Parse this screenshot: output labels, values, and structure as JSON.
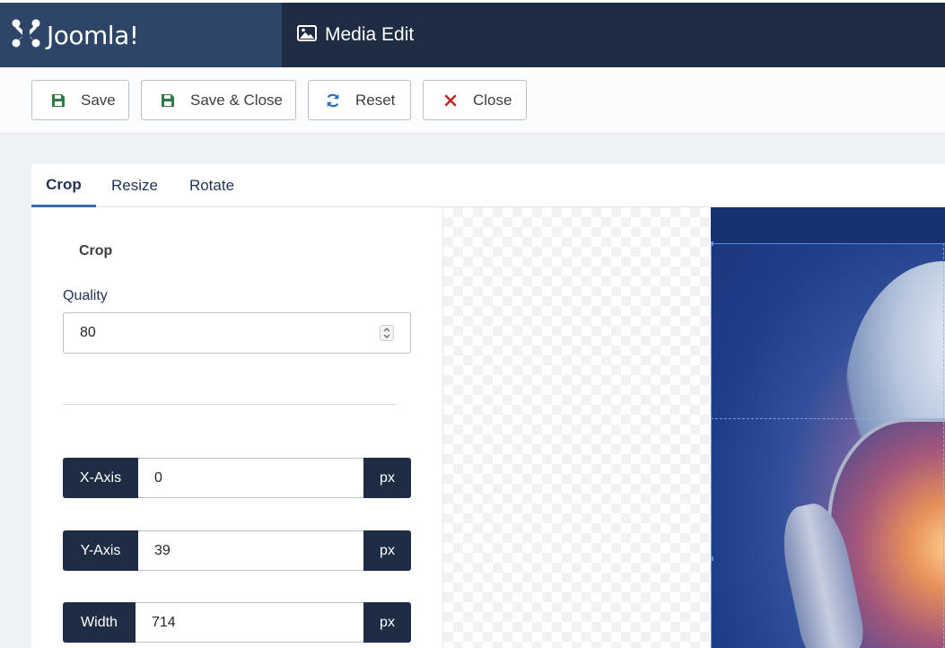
{
  "header": {
    "logo_text": "Joomla!",
    "page_title": "Media Edit"
  },
  "toolbar": {
    "save_label": "Save",
    "save_close_label": "Save & Close",
    "reset_label": "Reset",
    "close_label": "Close"
  },
  "tabs": [
    {
      "label": "Crop",
      "active": true
    },
    {
      "label": "Resize",
      "active": false
    },
    {
      "label": "Rotate",
      "active": false
    }
  ],
  "crop_panel": {
    "title": "Crop",
    "quality_label": "Quality",
    "quality_value": "80",
    "x_axis_label": "X-Axis",
    "x_axis_value": "0",
    "y_axis_label": "Y-Axis",
    "y_axis_value": "39",
    "width_label": "Width",
    "width_value": "714",
    "unit": "px"
  },
  "icons": {
    "logo": "joomla-logo-icon",
    "title": "image-icon",
    "save": "floppy-disk-icon",
    "save_close": "floppy-disk-icon",
    "reset": "refresh-icon",
    "close": "close-icon"
  },
  "colors": {
    "header_bg": "#1f2d44",
    "logo_bg": "#2d4567",
    "save_icon": "#2f7a46",
    "reset_icon": "#2f6dbf",
    "close_icon": "#c22727",
    "tab_active_border": "#3a6ab5"
  }
}
